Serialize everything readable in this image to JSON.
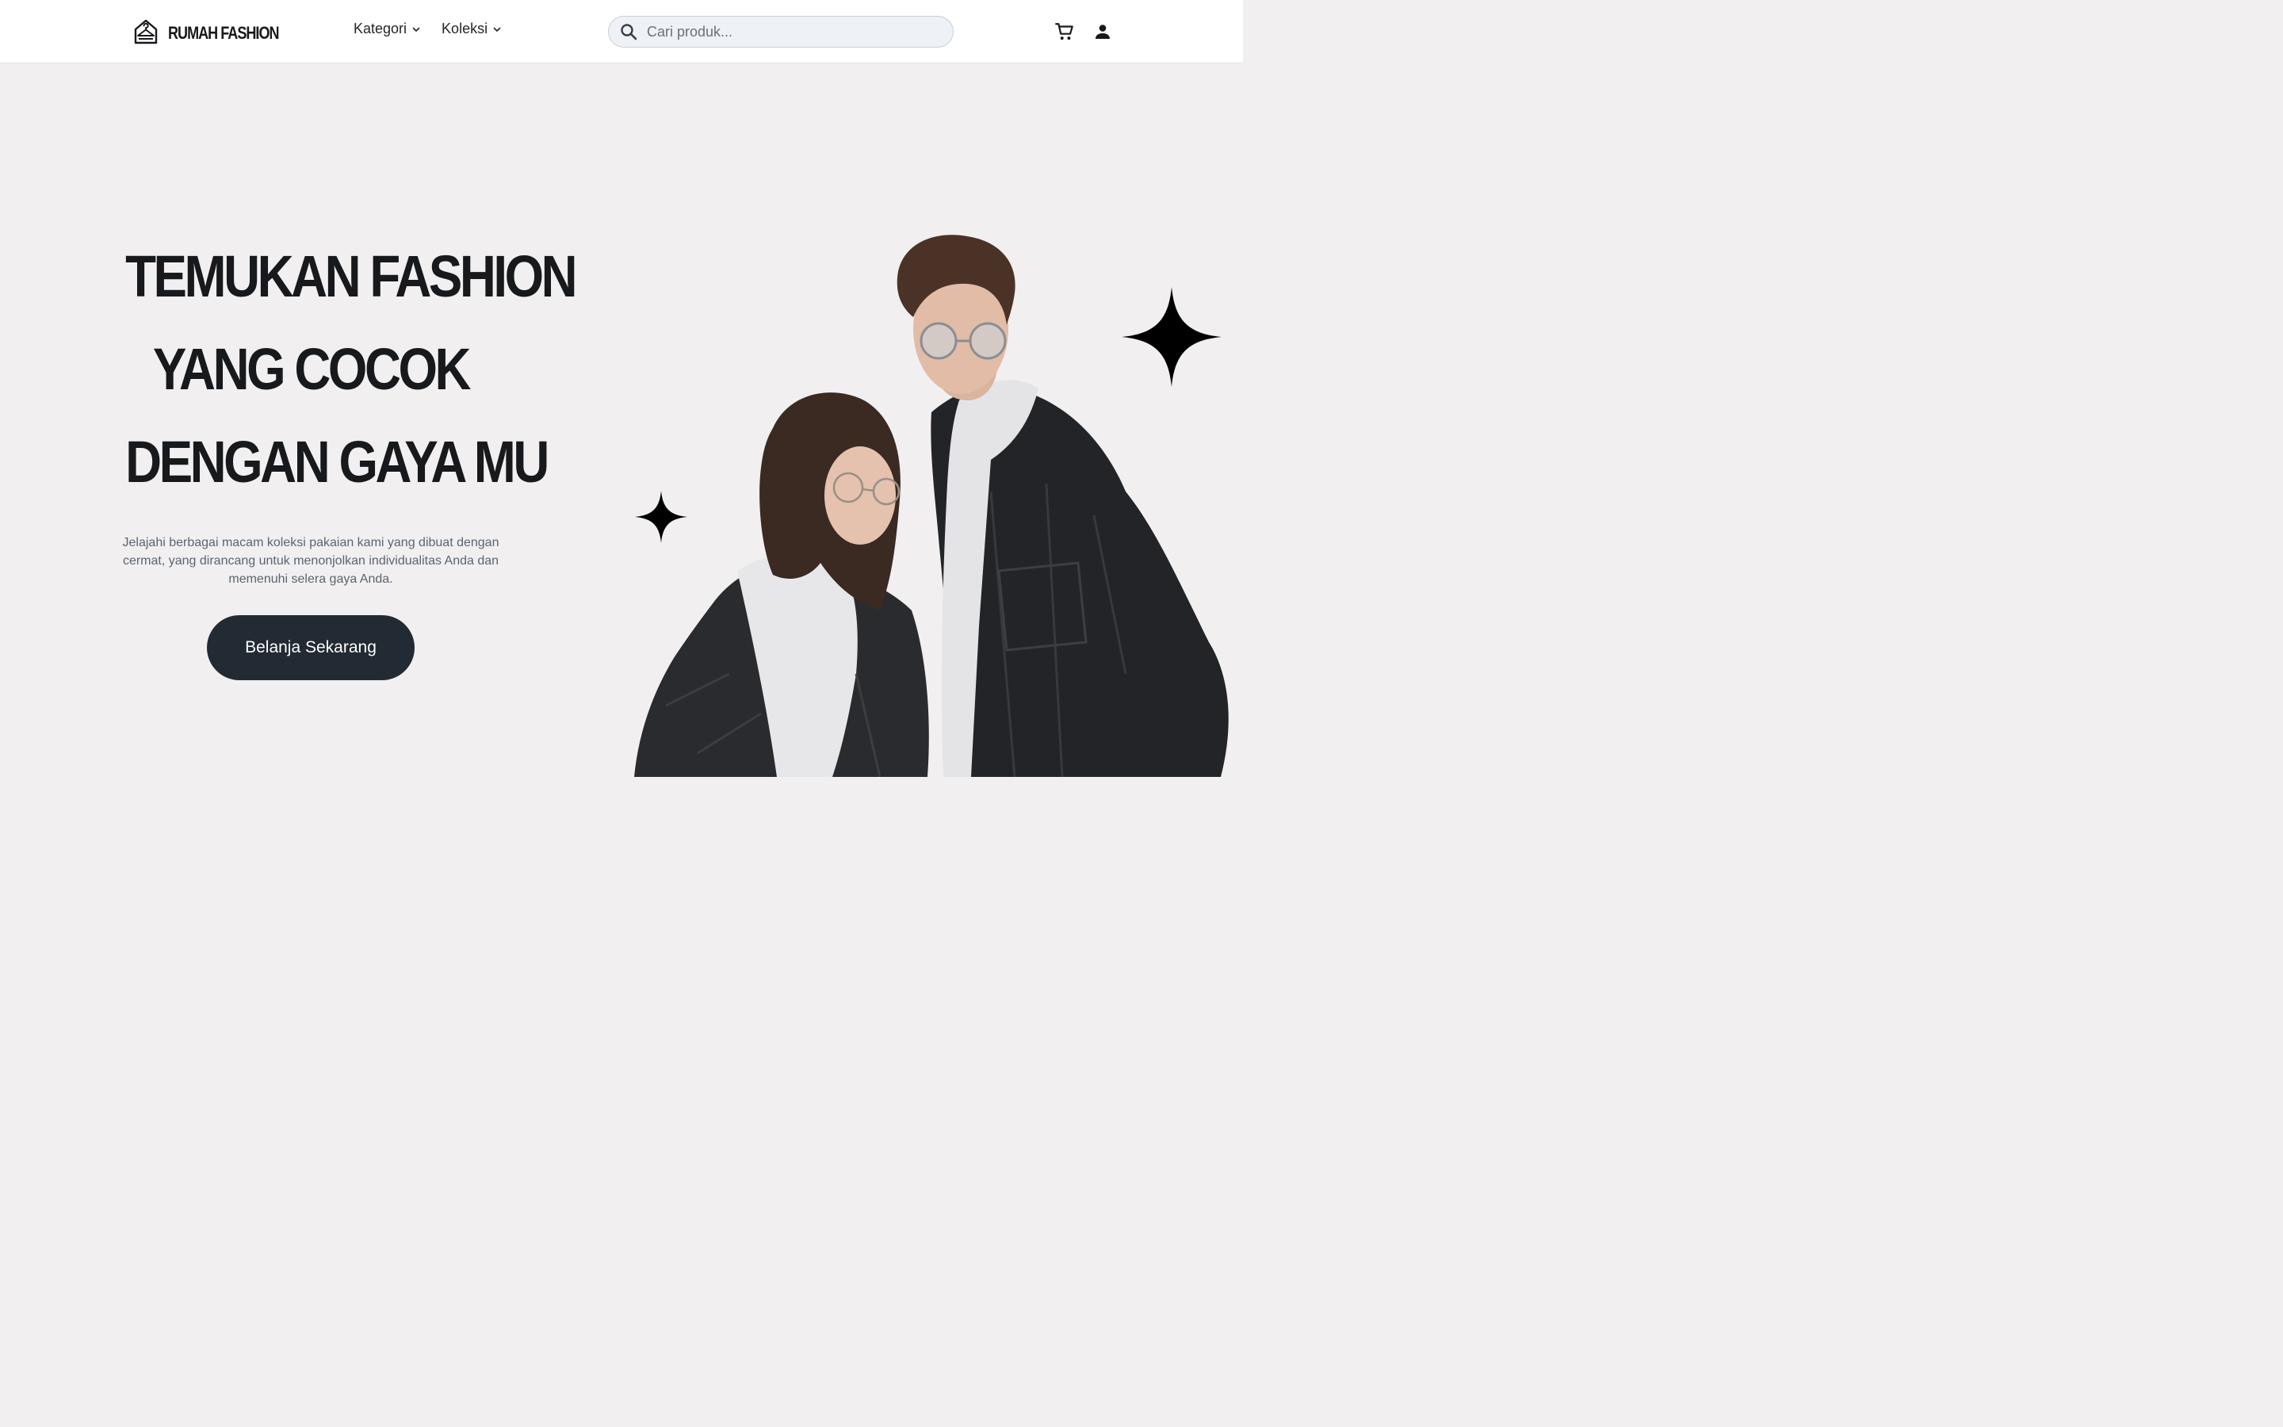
{
  "header": {
    "brand": "RUMAH FASHION",
    "nav": [
      {
        "label": "Kategori"
      },
      {
        "label": "Koleksi"
      }
    ],
    "search": {
      "placeholder": "Cari produk...",
      "value": ""
    },
    "icons": {
      "logo": "hanger-house-icon",
      "search": "search-icon",
      "cart": "cart-icon",
      "user": "user-icon",
      "nav_chevron": "chevron-down-icon"
    }
  },
  "hero": {
    "title_lines": [
      "TEMUKAN FASHION",
      "YANG COCOK",
      "DENGAN GAYA MU"
    ],
    "description": "Jelajahi berbagai macam koleksi pakaian kami yang dibuat dengan cermat, yang dirancang untuk menonjolkan individualitas Anda dan memenuhi selera gaya Anda.",
    "cta_label": "Belanja Sekarang"
  },
  "colors": {
    "page_background": "#f1eff0",
    "header_background": "#ffffff",
    "search_background": "#eef2f6",
    "button_background": "#222a33",
    "button_text": "#ffffff",
    "heading_text": "#17191c",
    "body_text": "#5d6470"
  }
}
